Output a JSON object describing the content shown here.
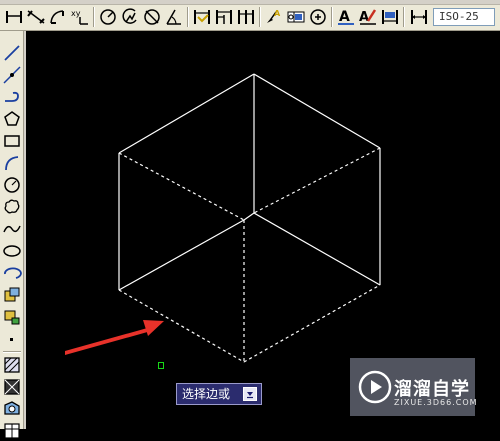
{
  "toolbar": {
    "dimension_style": "ISO-25",
    "buttons": [
      "linear-dimension-icon",
      "aligned-dimension-icon",
      "arc-length-dimension-icon",
      "ordinate-dimension-icon",
      "radius-dimension-icon",
      "jogged-dimension-icon",
      "diameter-dimension-icon",
      "angular-dimension-icon",
      "quick-dimension-icon",
      "baseline-dimension-icon",
      "continue-dimension-icon",
      "quick-leader-icon",
      "tolerance-icon",
      "center-mark-icon",
      "dimension-edit-icon",
      "dimension-text-edit-icon",
      "dimension-update-icon"
    ]
  },
  "left_toolbar": {
    "buttons": [
      "line-icon",
      "construction-line-icon",
      "polyline-icon",
      "polygon-icon",
      "rectangle-icon",
      "arc-icon",
      "circle-icon",
      "revision-cloud-icon",
      "spline-icon",
      "ellipse-icon",
      "ellipse-arc-icon",
      "insert-block-icon",
      "make-block-icon",
      "point-icon",
      "hatch-icon",
      "gradient-icon",
      "region-icon",
      "table-icon"
    ]
  },
  "prompt": {
    "text": "选择边或",
    "dropdown_icon": "dropdown-arrow-icon"
  },
  "watermark": {
    "title": "溜溜自学",
    "subtitle": "ZIXUE.3D66.COM"
  },
  "colors": {
    "canvas": "#000000",
    "toolbar": "#ece9d8",
    "cube_lines": "#ffffff",
    "arrow": "#e8322a",
    "prompt_bg": "#2b2c6e",
    "cursor_box": "#17d817"
  }
}
